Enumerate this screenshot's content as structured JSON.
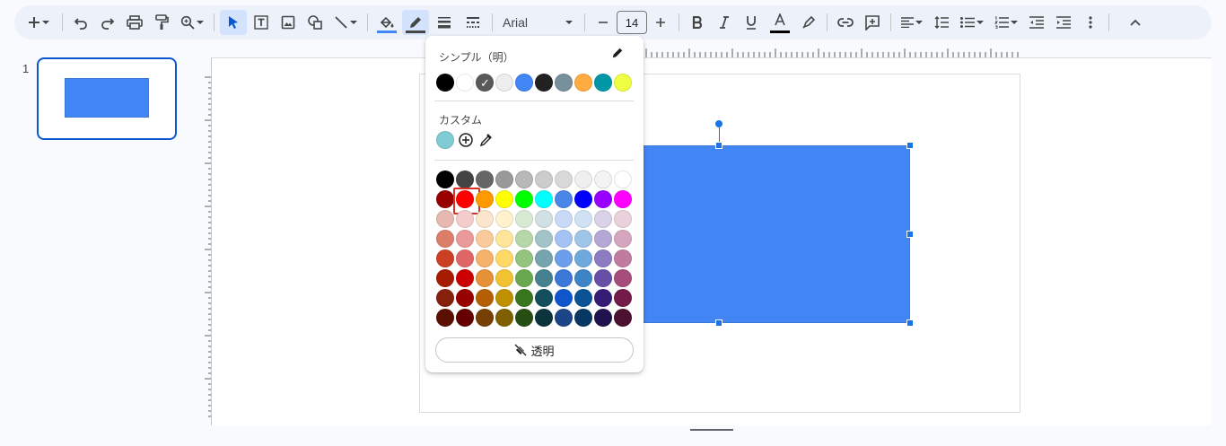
{
  "toolbar": {
    "font_name": "Arial",
    "font_size": "14",
    "text_color_swatch": "#000000",
    "fill_color_swatch": "#4285f4",
    "border_color_swatch": "#444746"
  },
  "filmstrip": {
    "slide_number": "1"
  },
  "shape": {
    "fill_color": "#4285f4"
  },
  "color_popup": {
    "simple_label": "シンプル（明）",
    "custom_label": "カスタム",
    "transparent_label": "透明",
    "simple_colors": [
      "#000000",
      "#ffffff",
      "#595959",
      "#eeeeee",
      "#4285f4",
      "#212121",
      "#78909c",
      "#ffab40",
      "#0097a7",
      "#eeff41"
    ],
    "simple_selected_index": 2,
    "custom_colors": [
      "#80cbd4"
    ],
    "grid_colors": [
      [
        "#000000",
        "#434343",
        "#666666",
        "#999999",
        "#b7b7b7",
        "#cccccc",
        "#d9d9d9",
        "#efefef",
        "#f3f3f3",
        "#ffffff"
      ],
      [
        "#980000",
        "#ff0000",
        "#ff9900",
        "#ffff00",
        "#00ff00",
        "#00ffff",
        "#4a86e8",
        "#0000ff",
        "#9900ff",
        "#ff00ff"
      ],
      [
        "#e6b8af",
        "#f4cccc",
        "#fce5cd",
        "#fff2cc",
        "#d9ead3",
        "#d0e0e3",
        "#c9daf8",
        "#cfe2f3",
        "#d9d2e9",
        "#ead1dc"
      ],
      [
        "#dd7e6b",
        "#ea9999",
        "#f9cb9c",
        "#ffe599",
        "#b6d7a8",
        "#a2c4c9",
        "#a4c2f4",
        "#9fc5e8",
        "#b4a7d6",
        "#d5a6bd"
      ],
      [
        "#cc4125",
        "#e06666",
        "#f6b26b",
        "#ffd966",
        "#93c47d",
        "#76a5af",
        "#6d9eeb",
        "#6fa8dc",
        "#8e7cc3",
        "#c27ba0"
      ],
      [
        "#a61c00",
        "#cc0000",
        "#e69138",
        "#f1c232",
        "#6aa84f",
        "#45818e",
        "#3c78d8",
        "#3d85c6",
        "#674ea7",
        "#a64d79"
      ],
      [
        "#85200c",
        "#990000",
        "#b45f06",
        "#bf9000",
        "#38761d",
        "#134f5c",
        "#1155cc",
        "#0b5394",
        "#351c75",
        "#741b47"
      ],
      [
        "#5b0f00",
        "#660000",
        "#783f04",
        "#7f6000",
        "#274e13",
        "#0c343d",
        "#1c4587",
        "#073763",
        "#20124d",
        "#4c1130"
      ]
    ],
    "grid_selected": [
      1,
      1
    ]
  }
}
